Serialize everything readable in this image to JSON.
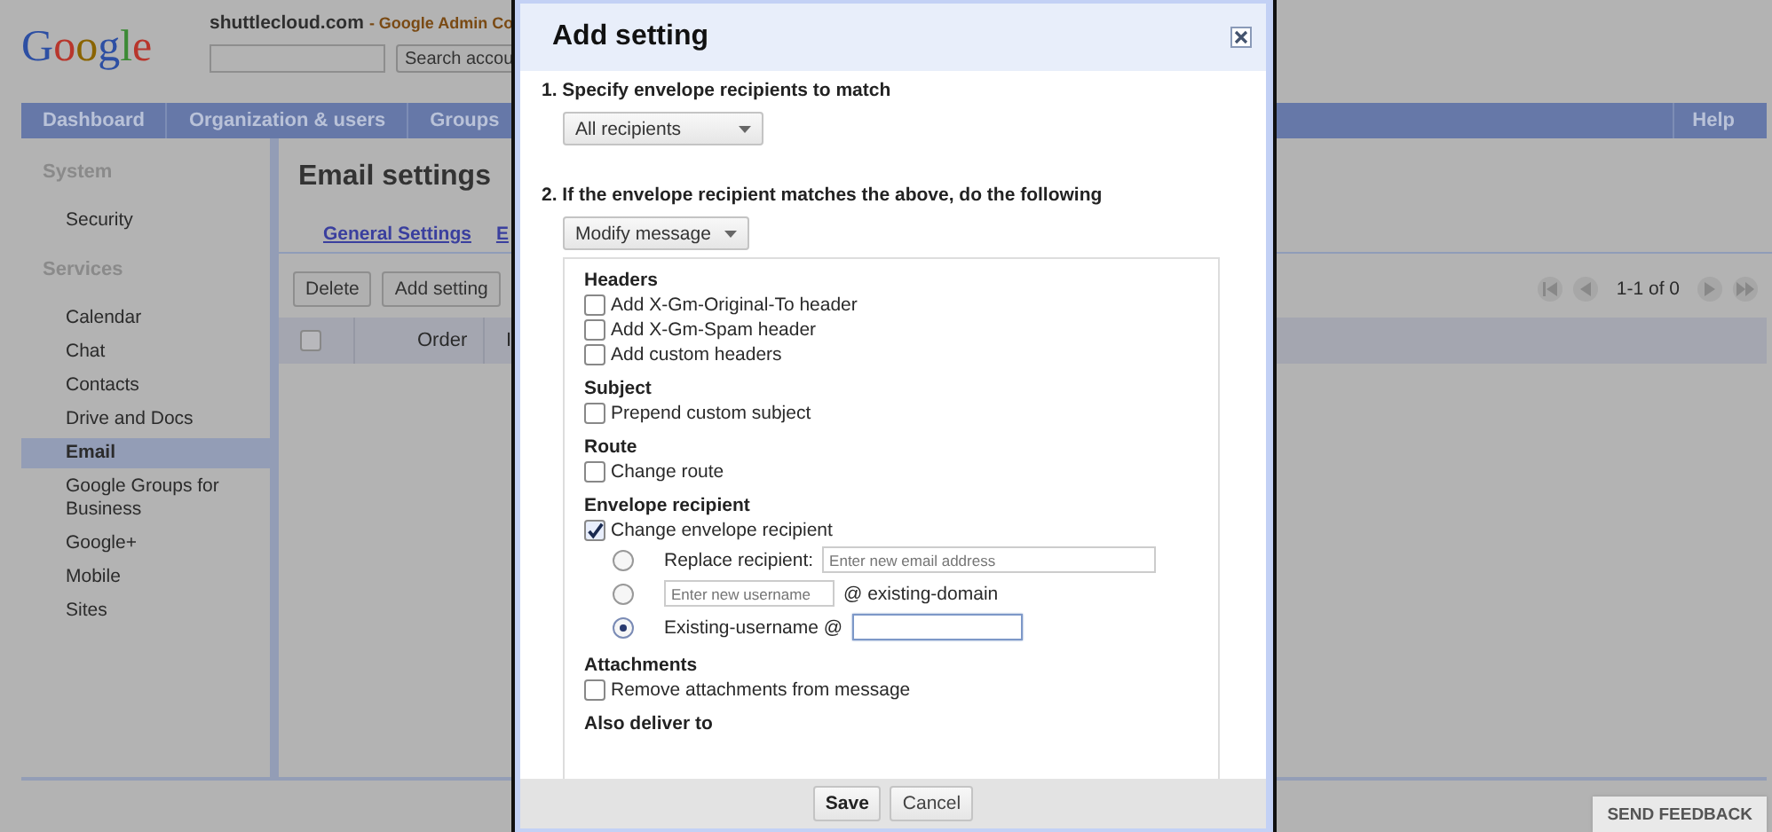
{
  "header": {
    "logo": "Google",
    "domain": "shuttlecloud.com",
    "product": "- Google Admin Co",
    "search_button": "Search accou"
  },
  "nav": {
    "items": [
      {
        "label": "Dashboard",
        "selected": false
      },
      {
        "label": "Organization & users",
        "selected": false
      },
      {
        "label": "Groups",
        "selected": false
      }
    ],
    "help": "Help"
  },
  "sidebar": {
    "sections": [
      {
        "title": "System",
        "items": [
          {
            "label": "Security",
            "selected": false
          }
        ]
      },
      {
        "title": "Services",
        "items": [
          {
            "label": "Calendar",
            "selected": false
          },
          {
            "label": "Chat",
            "selected": false
          },
          {
            "label": "Contacts",
            "selected": false
          },
          {
            "label": "Drive and Docs",
            "selected": false
          },
          {
            "label": "Email",
            "selected": true
          },
          {
            "label": "Google Groups for Business",
            "selected": false
          },
          {
            "label": "Google+",
            "selected": false
          },
          {
            "label": "Mobile",
            "selected": false
          },
          {
            "label": "Sites",
            "selected": false
          }
        ]
      }
    ]
  },
  "main": {
    "title": "Email settings",
    "tabs": [
      "General Settings",
      "E"
    ],
    "buttons": [
      "Delete",
      "Add setting"
    ],
    "table": {
      "select_all": {
        "checked": false
      },
      "columns": [
        "Order",
        "I"
      ]
    },
    "pagination": "1-1 of 0"
  },
  "dialog": {
    "title": "Add setting",
    "step1": {
      "label": "1. Specify envelope recipients to match",
      "dropdown": "All recipients"
    },
    "step2": {
      "label": "2. If the envelope recipient matches the above, do the following",
      "dropdown": "Modify message"
    },
    "groups": [
      {
        "title": "Headers",
        "options": [
          {
            "kind": "checkbox",
            "label": "Add X-Gm-Original-To header",
            "checked": false
          },
          {
            "kind": "checkbox",
            "label": "Add X-Gm-Spam header",
            "checked": false
          },
          {
            "kind": "checkbox",
            "label": "Add custom headers",
            "checked": false
          }
        ]
      },
      {
        "title": "Subject",
        "options": [
          {
            "kind": "checkbox",
            "label": "Prepend custom subject",
            "checked": false
          }
        ]
      },
      {
        "title": "Route",
        "options": [
          {
            "kind": "checkbox",
            "label": "Change route",
            "checked": false
          }
        ]
      },
      {
        "title": "Envelope recipient",
        "options": [
          {
            "kind": "checkbox",
            "label": "Change envelope recipient",
            "checked": true
          },
          {
            "kind": "radio",
            "selected": false,
            "prefix": "Replace recipient:",
            "placeholder": "Enter new email address",
            "focused": false
          },
          {
            "kind": "radio",
            "selected": false,
            "placeholder": "Enter new username",
            "suffix": "@ existing-domain",
            "focused": false
          },
          {
            "kind": "radio",
            "selected": true,
            "prefix": "Existing-username @",
            "focused": true
          }
        ]
      },
      {
        "title": "Attachments",
        "options": [
          {
            "kind": "checkbox",
            "label": "Remove attachments from message",
            "checked": false
          }
        ]
      },
      {
        "title": "Also deliver to"
      }
    ],
    "buttons": [
      "Save",
      "Cancel"
    ]
  },
  "feedback": "SEND FEEDBACK"
}
